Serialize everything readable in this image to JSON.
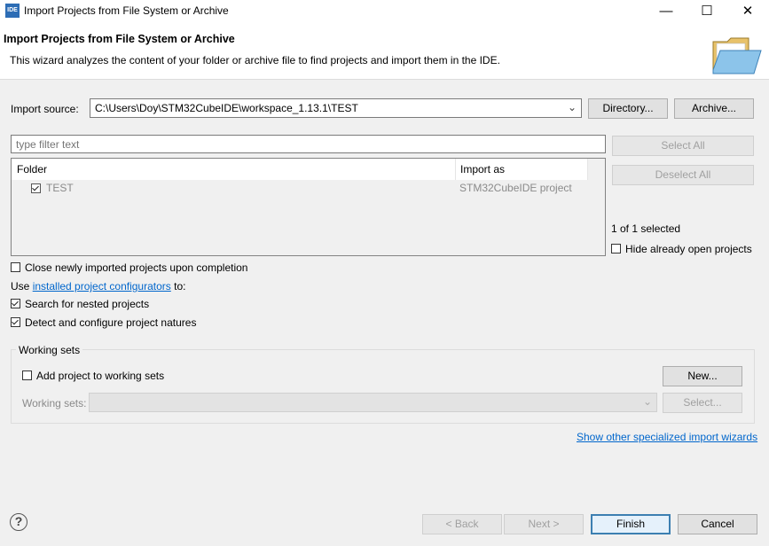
{
  "window": {
    "title": "Import Projects from File System or Archive",
    "app_icon_text": "IDE",
    "minimize_glyph": "—",
    "maximize_glyph": "☐",
    "close_glyph": "✕"
  },
  "header": {
    "title": "Import Projects from File System or Archive",
    "description": "This wizard analyzes the content of your folder or archive file to find projects and import them in the IDE.",
    "icon": "folder-open-icon"
  },
  "import_source": {
    "label": "Import source:",
    "value": "C:\\Users\\Doy\\STM32CubeIDE\\workspace_1.13.1\\TEST",
    "directory_button": "Directory...",
    "archive_button": "Archive..."
  },
  "filter": {
    "placeholder": "type filter text"
  },
  "table": {
    "columns": [
      "Folder",
      "Import as"
    ],
    "rows": [
      {
        "checked": true,
        "folder": "TEST",
        "import_as": "STM32CubeIDE project"
      }
    ]
  },
  "side_buttons": {
    "select_all": "Select All",
    "deselect_all": "Deselect All",
    "selection_count": "1 of 1 selected",
    "hide_open_label": "Hide already open projects"
  },
  "options": {
    "close_imported": "Close newly imported projects upon completion",
    "use_prefix": "Use",
    "configurators_link": "installed project configurators",
    "use_suffix": "to:",
    "search_nested": "Search for nested projects",
    "detect_natures": "Detect and configure project natures"
  },
  "working_sets": {
    "group_label": "Working sets",
    "add_label": "Add project to working sets",
    "new_button": "New...",
    "sets_label": "Working sets:",
    "select_button": "Select..."
  },
  "footer": {
    "specialized_link": "Show other specialized import wizards",
    "help_glyph": "?",
    "back_button": "< Back",
    "next_button": "Next >",
    "finish_button": "Finish",
    "cancel_button": "Cancel"
  },
  "colors": {
    "accent": "#0066cc",
    "default_button_border": "#3c7fb1"
  }
}
